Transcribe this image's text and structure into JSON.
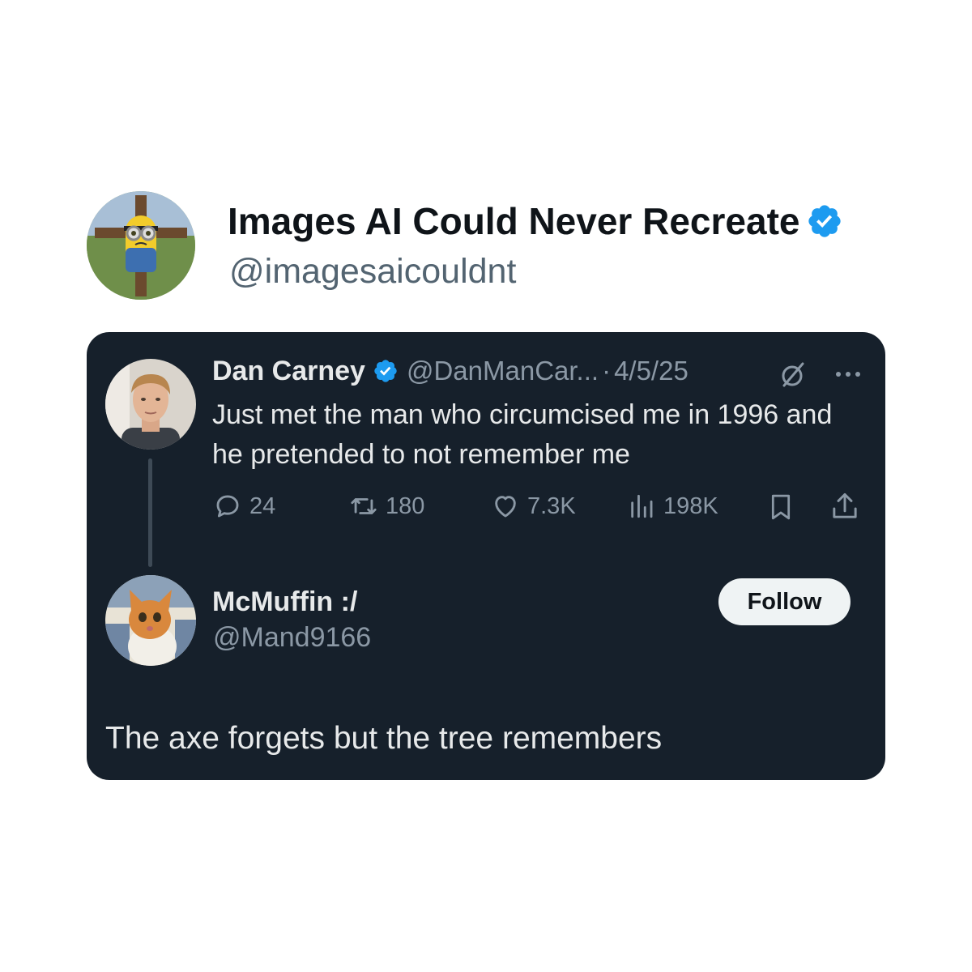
{
  "account": {
    "name": "Images AI Could Never Recreate",
    "handle": "@imagesaicouldnt",
    "avatar_icon": "minion-on-cross-avatar",
    "verified_icon": "verified-badge-icon"
  },
  "quoted_tweet": {
    "author": {
      "name": "Dan Carney",
      "handle": "@DanManCar...",
      "avatar_icon": "man-portrait-avatar",
      "verified_icon": "verified-badge-icon"
    },
    "separator": "·",
    "date": "4/5/25",
    "text": "Just met the man who circumcised me in 1996 and he pretended to not remember me",
    "actions": {
      "replies": "24",
      "retweets": "180",
      "likes": "7.3K",
      "views": "198K"
    },
    "icons": [
      "grok-icon",
      "more-icon",
      "reply-icon",
      "retweet-icon",
      "like-icon",
      "views-icon",
      "bookmark-icon",
      "share-icon"
    ]
  },
  "reply": {
    "author": {
      "name": "McMuffin :/",
      "handle": "@Mand9166",
      "avatar_icon": "orange-cat-avatar"
    },
    "follow_label": "Follow",
    "text": "The axe forgets but the tree remembers"
  },
  "colors": {
    "verified_blue": "#1d9bf0",
    "card_background": "#16202b",
    "primary_text_dark": "#e7e9ea",
    "secondary_text_dark": "#8b98a5"
  }
}
